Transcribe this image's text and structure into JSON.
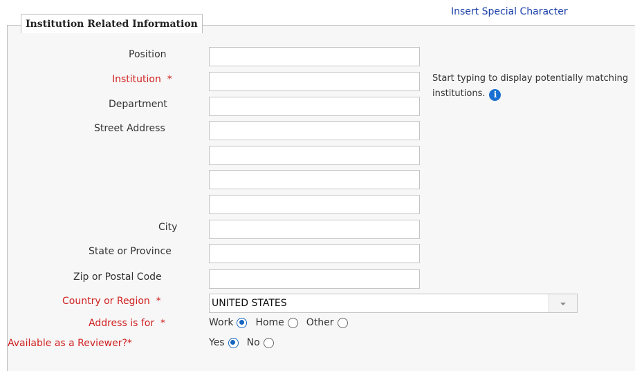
{
  "header": {
    "special_char_link": "Insert Special Character"
  },
  "section": {
    "legend": "Institution Related Information"
  },
  "fields": {
    "position": {
      "label": "Position",
      "value": ""
    },
    "institution": {
      "label": "Institution",
      "required_mark": "*",
      "value": ""
    },
    "department": {
      "label": "Department",
      "value": ""
    },
    "street_address": {
      "label": "Street Address",
      "lines": [
        "",
        "",
        "",
        ""
      ]
    },
    "city": {
      "label": "City",
      "value": ""
    },
    "state": {
      "label": "State or Province",
      "value": ""
    },
    "zip": {
      "label": "Zip or Postal Code",
      "value": ""
    },
    "country": {
      "label": "Country or Region",
      "required_mark": "*",
      "selected": "UNITED STATES"
    },
    "address_for": {
      "label": "Address is for",
      "required_mark": "*",
      "options": [
        "Work",
        "Home",
        "Other"
      ],
      "selected": "Work"
    },
    "reviewer": {
      "label": "Available as a Reviewer?*",
      "options": [
        "Yes",
        "No"
      ],
      "selected": "Yes"
    }
  },
  "institution_hint": {
    "text": "Start typing to display potentially matching institutions.",
    "icon": "info-icon"
  },
  "colors": {
    "required": "#d02020",
    "link": "#1a3fa8",
    "radio_selected": "#1565c0",
    "info_icon": "#1a6fd1"
  }
}
